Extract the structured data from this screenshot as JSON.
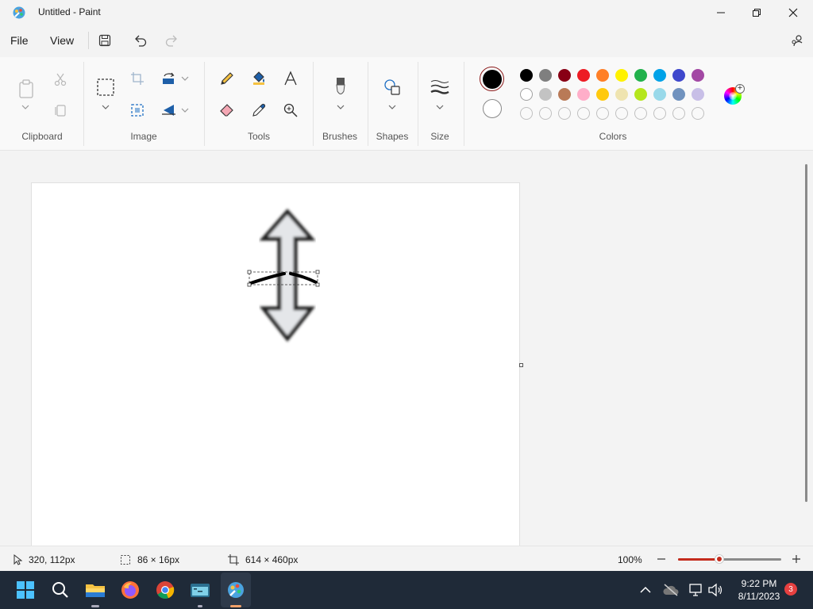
{
  "window": {
    "title": "Untitled - Paint"
  },
  "menu": {
    "file": "File",
    "view": "View"
  },
  "ribbon": {
    "groups": {
      "clipboard": "Clipboard",
      "image": "Image",
      "tools": "Tools",
      "brushes": "Brushes",
      "shapes": "Shapes",
      "size": "Size",
      "colors": "Colors"
    },
    "primary_color": "#000000",
    "secondary_color": "#ffffff",
    "palette_row1": [
      "#000000",
      "#7f7f7f",
      "#880015",
      "#ed1c24",
      "#ff7f27",
      "#fff200",
      "#22b14c",
      "#00a2e8",
      "#3f48cc",
      "#a349a4"
    ],
    "palette_row2": [
      "#ffffff",
      "#c3c3c3",
      "#b97a57",
      "#ffaec9",
      "#ffc90e",
      "#efe4b0",
      "#b5e61d",
      "#99d9ea",
      "#7092be",
      "#c8bfe7"
    ]
  },
  "status": {
    "cursor_pos": "320, 112px",
    "selection_size": "86 × 16px",
    "canvas_size": "614 × 460px",
    "zoom": "100%",
    "zoom_slider_fraction": 0.4
  },
  "taskbar": {
    "time": "9:22 PM",
    "date": "8/11/2023",
    "notification_count": "3"
  }
}
